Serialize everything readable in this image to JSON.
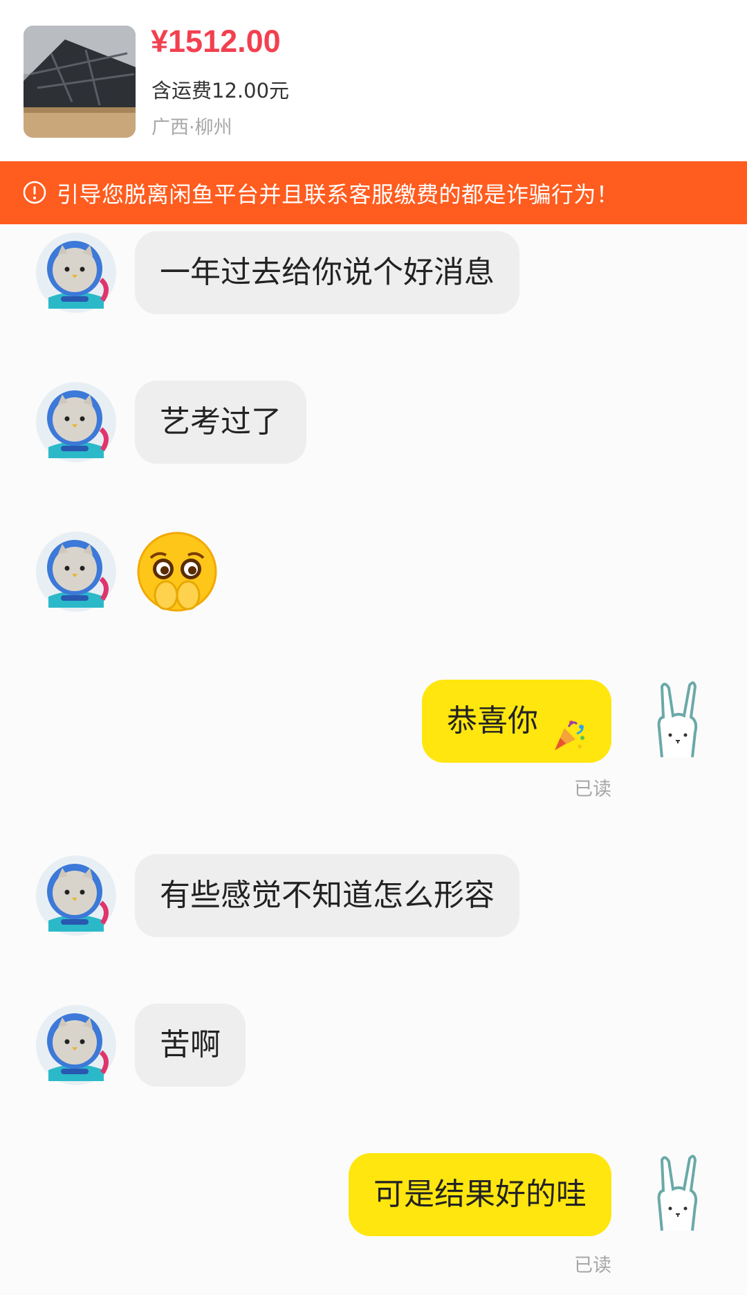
{
  "product": {
    "price": "¥1512.00",
    "shipping": "含运费12.00元",
    "location": "广西·柳州"
  },
  "warning": {
    "icon": "exclamation-circle-icon",
    "text": "引导您脱离闲鱼平台并且联系客服缴费的都是诈骗行为！"
  },
  "colors": {
    "price": "#f2404f",
    "banner": "#ff5c1f",
    "outgoing_bubble": "#ffe60f",
    "incoming_bubble": "#eeeeee"
  },
  "messages": [
    {
      "side": "in",
      "text": "一年过去给你说个好消息"
    },
    {
      "side": "in",
      "text": "艺考过了"
    },
    {
      "side": "in",
      "type": "emoji",
      "emoji": "pleading-face-emoji"
    },
    {
      "side": "out",
      "text": "恭喜你",
      "emoji": "party-popper-emoji",
      "status": "已读"
    },
    {
      "side": "in",
      "text": "有些感觉不知道怎么形容"
    },
    {
      "side": "in",
      "text": "苦啊"
    },
    {
      "side": "out",
      "text": "可是结果好的哇",
      "status": "已读"
    }
  ],
  "avatars": {
    "incoming": "astronaut-cat-avatar",
    "outgoing": "bunny-avatar"
  }
}
